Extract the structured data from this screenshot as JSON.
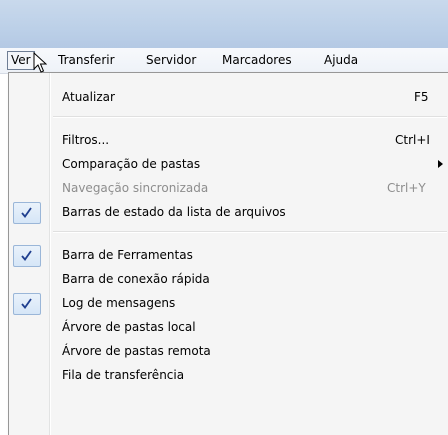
{
  "menubar": {
    "items": [
      {
        "label": "Ver",
        "active": true
      },
      {
        "label": "Transferir"
      },
      {
        "label": "Servidor"
      },
      {
        "label": "Marcadores"
      },
      {
        "label": "Ajuda"
      }
    ]
  },
  "menu": {
    "items": [
      {
        "label": "Atualizar",
        "shortcut": "F5",
        "checked": false,
        "disabled": false
      },
      {
        "label": "Filtros...",
        "shortcut": "Ctrl+I",
        "checked": false,
        "disabled": false
      },
      {
        "label": "Comparação de pastas",
        "shortcut": "",
        "submenu": true,
        "checked": false,
        "disabled": false
      },
      {
        "label": "Navegação sincronizada",
        "shortcut": "Ctrl+Y",
        "checked": false,
        "disabled": true
      },
      {
        "label": "Barras de estado da lista de arquivos",
        "shortcut": "",
        "checked": true,
        "disabled": false
      },
      {
        "label": "Barra de Ferramentas",
        "shortcut": "",
        "checked": true,
        "disabled": false
      },
      {
        "label": "Barra de conexão rápida",
        "shortcut": "",
        "checked": false,
        "disabled": false
      },
      {
        "label": "Log de mensagens",
        "shortcut": "",
        "checked": true,
        "disabled": false
      },
      {
        "label": "Árvore de pastas local",
        "shortcut": "",
        "checked": false,
        "disabled": false
      },
      {
        "label": "Árvore de pastas remota",
        "shortcut": "",
        "checked": false,
        "disabled": false
      },
      {
        "label": "Fila de transferência",
        "shortcut": "",
        "checked": false,
        "disabled": false
      }
    ]
  },
  "colors": {
    "check": "#1f3f8f",
    "disabled_text": "#8d8d8d"
  },
  "icons": {
    "check": "checkmark-icon",
    "submenu": "submenu-arrow-icon",
    "cursor": "mouse-pointer-icon"
  }
}
